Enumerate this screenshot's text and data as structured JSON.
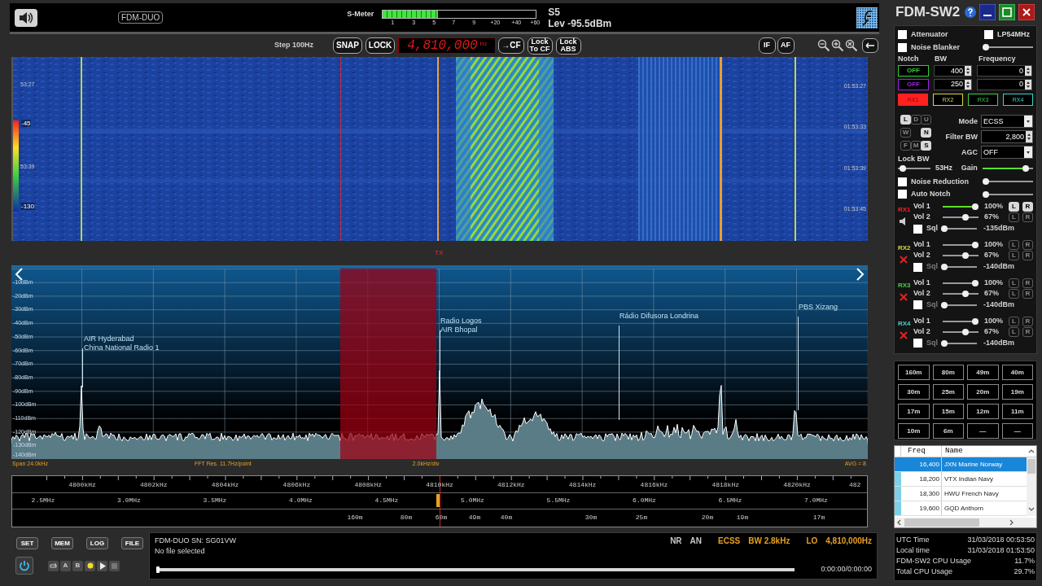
{
  "top": {
    "device_badge": "FDM-DUO",
    "smeter_label": "S-Meter",
    "smeter": {
      "level": 0.36
    },
    "smeter_scale": [
      "1",
      "3",
      "5",
      "7",
      "9",
      "+20",
      "+40",
      "+60"
    ],
    "s_reading": "S5",
    "level_reading": "Lev -95.5dBm"
  },
  "toolbar": {
    "step": "Step 100Hz",
    "buttons": [
      "SNAP",
      "LOCK"
    ],
    "frequency": "4,810,000",
    "frequency_unit": "Hz",
    "center_button": "→CF",
    "lock_buttons": [
      "Lock To CF",
      "Lock ABS"
    ],
    "filter_buttons": [
      "IF",
      "AF"
    ]
  },
  "waterfall": {
    "left_times": [
      "53:27",
      "53:39"
    ],
    "scale": [
      "-45",
      "-130"
    ],
    "right_times": [
      "01:53:27",
      "01:53:33",
      "01:53:39",
      "01:53:45"
    ],
    "tx_label": "TX"
  },
  "spectrum": {
    "dbm_labels": [
      "-10dBm",
      "-20dBm",
      "-30dBm",
      "-40dBm",
      "-50dBm",
      "-60dBm",
      "-70dBm",
      "-80dBm",
      "-90dBm",
      "-100dBm",
      "-110dBm",
      "-120dBm",
      "-130dBm",
      "-140dBm"
    ],
    "stations": [
      {
        "lines": [
          "AIR Hyderabad",
          "China National Radio 1"
        ]
      },
      {
        "lines": [
          "Radio Logos",
          "AIR Bhopal"
        ]
      },
      {
        "lines": [
          "Rádio Difusora Londrina"
        ]
      },
      {
        "lines": [
          "PBS Xizang"
        ]
      }
    ],
    "span": "Span 24.0kHz",
    "fft": "FFT Res. 11.7Hz/point",
    "div": "2.0kHz/div",
    "avg": "AVG = 8"
  },
  "scale": {
    "khz": [
      "4800kHz",
      "4802kHz",
      "4804kHz",
      "4806kHz",
      "4808kHz",
      "4810kHz",
      "4812kHz",
      "4814kHz",
      "4816kHz",
      "4818kHz",
      "4820kHz",
      "482"
    ],
    "mhz": [
      "2.5MHz",
      "3.0MHz",
      "3.5MHz",
      "4.0MHz",
      "4.5MHz",
      "5.0MHz",
      "5.5MHz",
      "6.0MHz",
      "6.5MHz",
      "7.0MHz"
    ],
    "bands": [
      "160m",
      "80m",
      "60m",
      "49m",
      "40m",
      "30m",
      "25m",
      "20m",
      "19m",
      "17m"
    ]
  },
  "bottom": {
    "buttons": [
      "SET",
      "MEM",
      "LOG",
      "FILE"
    ],
    "ab": [
      "A",
      "B"
    ],
    "device": "FDM-DUO SN: SG01VW",
    "file": "No file selected",
    "indicators": [
      {
        "label": "NR",
        "color": "#c8c8c8"
      },
      {
        "label": "AN",
        "color": "#c8c8c8"
      },
      {
        "label": "ECSS",
        "color": "#e8a020"
      },
      {
        "label": "BW 2.8kHz",
        "color": "#e8a020"
      },
      {
        "label": "LO",
        "color": "#e8a020"
      },
      {
        "label": "4,810,000Hz",
        "color": "#e8a020"
      }
    ],
    "playback": {
      "level": 0
    },
    "time": "0:00:00/0:00:00"
  },
  "right_panel": {
    "title": "FDM-SW2",
    "attenuator": {
      "label": "Attenuator",
      "checked": false
    },
    "lp54": {
      "label": "LP54MHz",
      "checked": false
    },
    "noise_blanker": {
      "label": "Noise Blanker",
      "checked": false,
      "level": 0
    },
    "notch_headers": [
      "Notch",
      "BW",
      "Frequency"
    ],
    "notch_rows": [
      {
        "state": "OFF",
        "color": "#30d030",
        "bw": "400",
        "freq": "0"
      },
      {
        "state": "OFF",
        "color": "#a020e0",
        "bw": "250",
        "freq": "0"
      }
    ],
    "rx_tabs": [
      {
        "label": "RX1",
        "selected": true,
        "color": "#ff2020"
      },
      {
        "label": "RX2",
        "selected": false,
        "color": "#d8d840"
      },
      {
        "label": "RX3",
        "selected": false,
        "color": "#40d040"
      },
      {
        "label": "RX4",
        "selected": false,
        "color": "#40d0d0"
      }
    ],
    "mode_letters": [
      {
        "label": "L",
        "on": true
      },
      {
        "label": "D",
        "on": false
      },
      {
        "label": "U",
        "on": false
      },
      {
        "label": "W",
        "on": false
      },
      {
        "label": "N",
        "on": true
      },
      {
        "label": "F",
        "on": false
      },
      {
        "label": "M",
        "on": false
      },
      {
        "label": "S",
        "on": true
      }
    ],
    "mode": {
      "label": "Mode",
      "value": "ECSS"
    },
    "filter_bw": {
      "label": "Filter BW",
      "value": "2,800"
    },
    "agc": {
      "label": "AGC",
      "value": "OFF"
    },
    "lock_bw": {
      "label": "Lock BW",
      "level": 0.05,
      "reading": "53Hz"
    },
    "gain": {
      "label": "Gain",
      "level": 0.9
    },
    "noise_reduction": {
      "label": "Noise Reduction",
      "checked": false,
      "level": 0
    },
    "auto_notch": {
      "label": "Auto Notch",
      "checked": false,
      "level": 0
    },
    "receivers": [
      {
        "label": "RX1",
        "color": "#ff2020",
        "muted": false,
        "vol1": {
          "label": "Vol 1",
          "active": true,
          "level": 1,
          "reading": "100%",
          "channels": [
            {
              "label": "L",
              "on": true
            },
            {
              "label": "R",
              "on": true
            }
          ]
        },
        "vol2": {
          "label": "Vol 2",
          "active": false,
          "level": 0.67,
          "reading": "67%",
          "channels": [
            {
              "label": "L",
              "on": false
            },
            {
              "label": "R",
              "on": false
            }
          ]
        },
        "squelch": {
          "label": "Sql",
          "checked": false,
          "enabled": true,
          "level": 0,
          "reading": "-135dBm"
        }
      },
      {
        "label": "RX2",
        "color": "#d8d840",
        "muted": true,
        "vol1": {
          "label": "Vol 1",
          "active": false,
          "level": 1,
          "reading": "100%",
          "channels": [
            {
              "label": "L",
              "on": false
            },
            {
              "label": "R",
              "on": false
            }
          ]
        },
        "vol2": {
          "label": "Vol 2",
          "active": false,
          "level": 0.67,
          "reading": "67%",
          "channels": [
            {
              "label": "L",
              "on": false
            },
            {
              "label": "R",
              "on": false
            }
          ]
        },
        "squelch": {
          "label": "Sql",
          "checked": false,
          "enabled": false,
          "level": 0,
          "reading": "-140dBm"
        }
      },
      {
        "label": "RX3",
        "color": "#40d040",
        "muted": true,
        "vol1": {
          "label": "Vol 1",
          "active": false,
          "level": 1,
          "reading": "100%",
          "channels": [
            {
              "label": "L",
              "on": false
            },
            {
              "label": "R",
              "on": false
            }
          ]
        },
        "vol2": {
          "label": "Vol 2",
          "active": false,
          "level": 0.67,
          "reading": "67%",
          "channels": [
            {
              "label": "L",
              "on": false
            },
            {
              "label": "R",
              "on": false
            }
          ]
        },
        "squelch": {
          "label": "Sql",
          "checked": false,
          "enabled": false,
          "level": 0,
          "reading": "-140dBm"
        }
      },
      {
        "label": "RX4",
        "color": "#40d0d0",
        "muted": true,
        "vol1": {
          "label": "Vol 1",
          "active": false,
          "level": 1,
          "reading": "100%",
          "channels": [
            {
              "label": "L",
              "on": false
            },
            {
              "label": "R",
              "on": false
            }
          ]
        },
        "vol2": {
          "label": "Vol 2",
          "active": false,
          "level": 0.67,
          "reading": "67%",
          "channels": [
            {
              "label": "L",
              "on": false
            },
            {
              "label": "R",
              "on": false
            }
          ]
        },
        "squelch": {
          "label": "Sql",
          "checked": false,
          "enabled": false,
          "level": 0,
          "reading": "-140dBm"
        }
      }
    ]
  },
  "band_buttons": [
    "160m",
    "80m",
    "49m",
    "40m",
    "30m",
    "25m",
    "20m",
    "19m",
    "17m",
    "15m",
    "12m",
    "11m",
    "10m",
    "6m",
    "—",
    "—"
  ],
  "memory_table": {
    "columns": [
      "Freq",
      "Name"
    ],
    "rows": [
      {
        "freq": "16,400",
        "name": "JXN Marine Norway",
        "selected": true
      },
      {
        "freq": "18,200",
        "name": "VTX Indian Navy",
        "selected": false
      },
      {
        "freq": "18,300",
        "name": "HWU French Navy",
        "selected": false
      },
      {
        "freq": "19,600",
        "name": "GQD Anthorn",
        "selected": false
      }
    ]
  },
  "system_info": [
    {
      "label": "UTC Time",
      "value": "31/03/2018 00:53:50"
    },
    {
      "label": "Local time",
      "value": "31/03/2018 01:53:50"
    },
    {
      "label": "FDM-SW2 CPU Usage",
      "value": "11.7%"
    },
    {
      "label": "Total CPU Usage",
      "value": "29.7%"
    }
  ]
}
